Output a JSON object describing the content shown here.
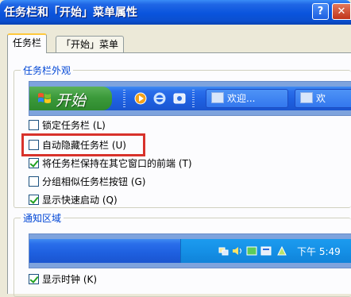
{
  "window": {
    "title": "任务栏和「开始」菜单属性"
  },
  "titlebar": {
    "help_label": "?",
    "close_label": "✕"
  },
  "tabs": [
    {
      "label": "任务栏",
      "active": true
    },
    {
      "label": "「开始」菜单",
      "active": false
    }
  ],
  "appearance_group": {
    "legend": "任务栏外观",
    "preview": {
      "start_label": "开始",
      "quick_launch_icons": [
        "media-player-icon",
        "ie-icon",
        "ie-alt-icon"
      ],
      "task_buttons": [
        {
          "label": "欢迎...",
          "icon": "window-icon"
        },
        {
          "label": "欢",
          "icon": "window-icon"
        }
      ]
    },
    "options": [
      {
        "label": "锁定任务栏 (L)",
        "checked": false
      },
      {
        "label": "自动隐藏任务栏 (U)",
        "checked": false,
        "highlighted": true
      },
      {
        "label": "将任务栏保持在其它窗口的前端 (T)",
        "checked": true
      },
      {
        "label": "分组相似任务栏按钮 (G)",
        "checked": false
      },
      {
        "label": "显示快速启动 (Q)",
        "checked": true
      }
    ]
  },
  "notification_group": {
    "legend": "通知区域",
    "preview": {
      "tray_icons": [
        "tray-network-icon",
        "tray-volume-icon",
        "tray-app-icon",
        "tray-app2-icon"
      ],
      "clock": "下午 5:49"
    },
    "options": [
      {
        "label": "显示时钟 (K)",
        "checked": true
      }
    ]
  },
  "colors": {
    "titlebar_blue": "#0A54DD",
    "highlight_red": "#D8322B",
    "legend_blue": "#0046D5",
    "check_green": "#21A121"
  }
}
